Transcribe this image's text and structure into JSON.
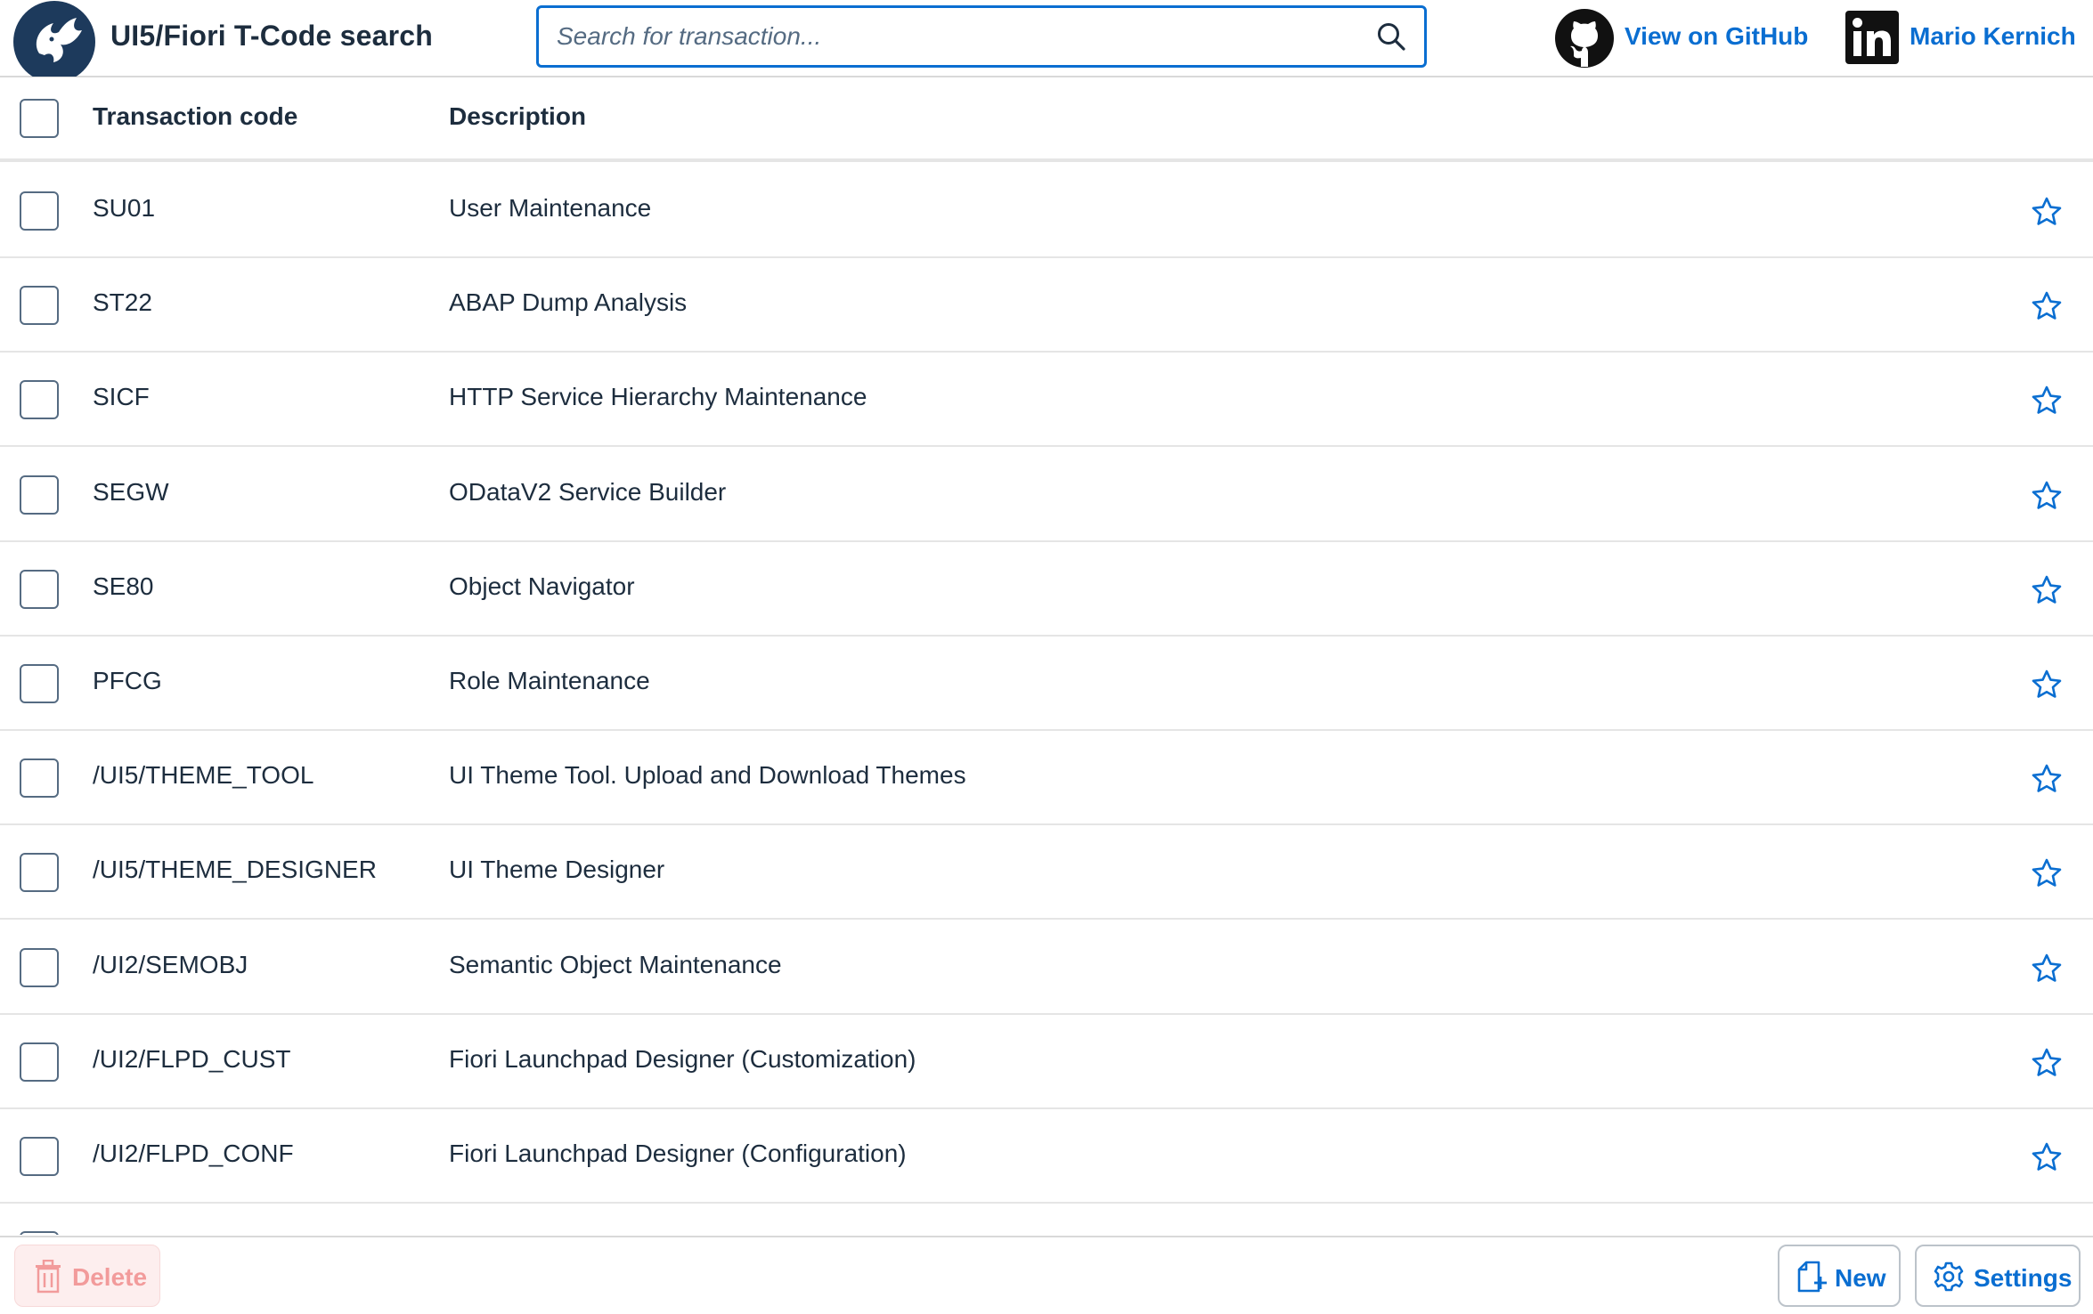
{
  "header": {
    "title": "UI5/Fiori T-Code search",
    "search_placeholder": "Search for transaction...",
    "search_value": "",
    "github_label": "View on GitHub",
    "author_label": "Mario Kernich"
  },
  "table": {
    "columns": [
      "Transaction code",
      "Description"
    ],
    "rows": [
      {
        "code": "SU01",
        "description": "User Maintenance"
      },
      {
        "code": "ST22",
        "description": "ABAP Dump Analysis"
      },
      {
        "code": "SICF",
        "description": "HTTP Service Hierarchy Maintenance"
      },
      {
        "code": "SEGW",
        "description": "ODataV2 Service Builder"
      },
      {
        "code": "SE80",
        "description": "Object Navigator"
      },
      {
        "code": "PFCG",
        "description": "Role Maintenance"
      },
      {
        "code": "/UI5/THEME_TOOL",
        "description": "UI Theme Tool. Upload and Download Themes"
      },
      {
        "code": "/UI5/THEME_DESIGNER",
        "description": "UI Theme Designer"
      },
      {
        "code": "/UI2/SEMOBJ",
        "description": "Semantic Object Maintenance"
      },
      {
        "code": "/UI2/FLPD_CUST",
        "description": "Fiori Launchpad Designer (Customization)"
      },
      {
        "code": "/UI2/FLPD_CONF",
        "description": "Fiori Launchpad Designer (Configuration)"
      },
      {
        "code": "",
        "description": ""
      }
    ]
  },
  "footer": {
    "delete_label": "Delete",
    "new_label": "New",
    "settings_label": "Settings"
  },
  "icons": {
    "logo": "phoenix-logo-icon",
    "search": "search-icon",
    "github": "github-icon",
    "linkedin": "linkedin-icon",
    "favorite": "star-outline-icon",
    "delete": "trash-icon",
    "new": "new-document-icon",
    "settings": "gear-icon"
  },
  "colors": {
    "accent": "#0a6ed1",
    "text": "#1d2d3e",
    "delete_disabled": "#f29b9b",
    "delete_bg": "#fdeeee"
  }
}
